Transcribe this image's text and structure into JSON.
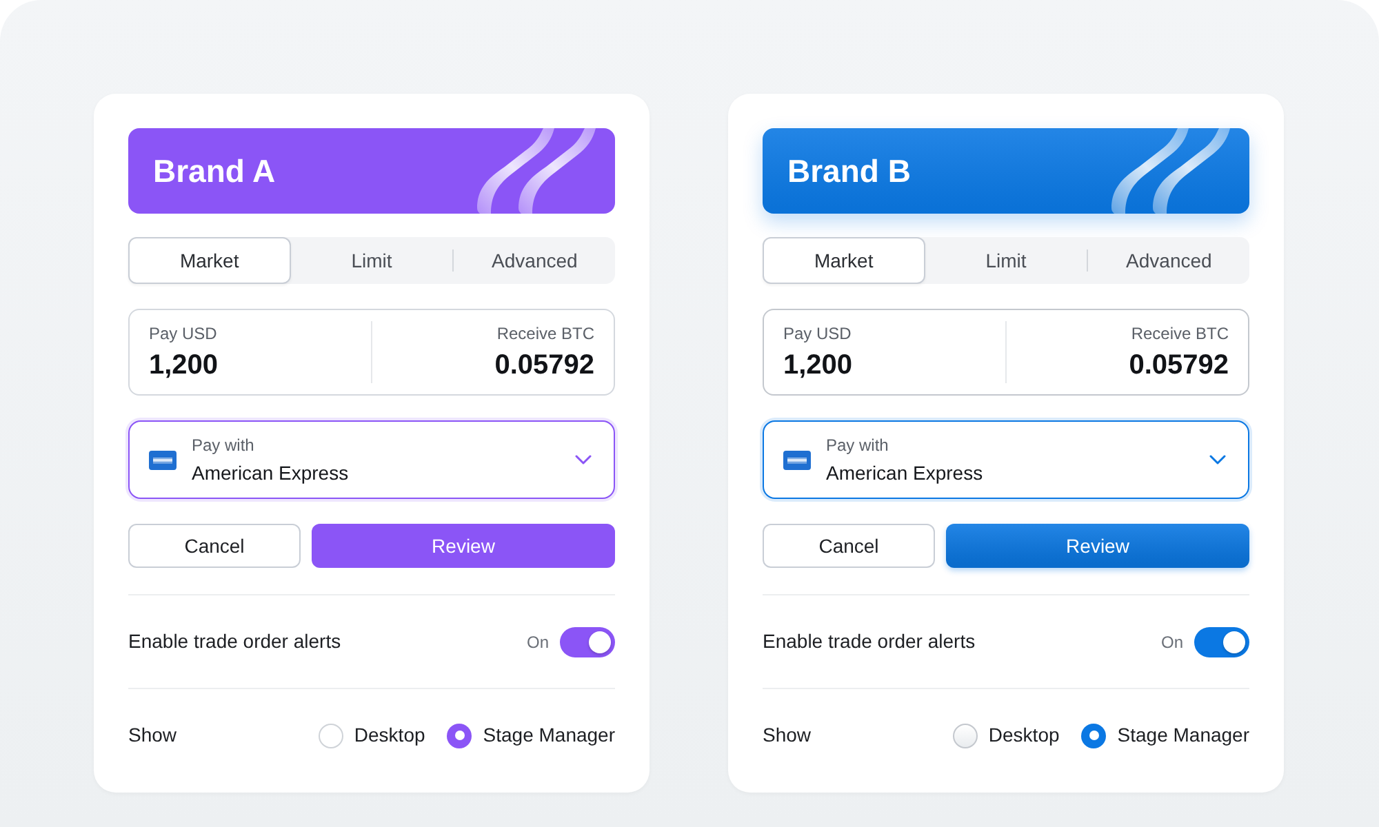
{
  "cards": [
    {
      "kind": "flat",
      "brand": "Brand A",
      "color": "#8b55f6",
      "tabs": [
        {
          "label": "Market",
          "selected": true
        },
        {
          "label": "Limit",
          "selected": false
        },
        {
          "label": "Advanced",
          "selected": false
        }
      ],
      "pay": {
        "label": "Pay USD",
        "value": "1,200"
      },
      "receive": {
        "label": "Receive BTC",
        "value": "0.05792"
      },
      "payment_method": {
        "label": "Pay with",
        "value": "American Express",
        "focused": true
      },
      "buttons": [
        {
          "label": "Cancel",
          "kind": "secondary"
        },
        {
          "label": "Review",
          "kind": "primary"
        }
      ],
      "alerts": {
        "label": "Enable trade order alerts",
        "state_label": "On",
        "on": true
      },
      "show": {
        "label": "Show",
        "options": [
          {
            "label": "Desktop",
            "selected": false
          },
          {
            "label": "Stage Manager",
            "selected": true
          }
        ]
      }
    },
    {
      "kind": "glossy",
      "brand": "Brand B",
      "color": "#0b78e3",
      "tabs": [
        {
          "label": "Market",
          "selected": true
        },
        {
          "label": "Limit",
          "selected": false
        },
        {
          "label": "Advanced",
          "selected": false
        }
      ],
      "pay": {
        "label": "Pay USD",
        "value": "1,200"
      },
      "receive": {
        "label": "Receive BTC",
        "value": "0.05792"
      },
      "payment_method": {
        "label": "Pay with",
        "value": "American Express",
        "focused": true
      },
      "buttons": [
        {
          "label": "Cancel",
          "kind": "secondary"
        },
        {
          "label": "Review",
          "kind": "primary"
        }
      ],
      "alerts": {
        "label": "Enable trade order alerts",
        "state_label": "On",
        "on": true
      },
      "show": {
        "label": "Show",
        "options": [
          {
            "label": "Desktop",
            "selected": false
          },
          {
            "label": "Stage Manager",
            "selected": true
          }
        ]
      }
    }
  ]
}
